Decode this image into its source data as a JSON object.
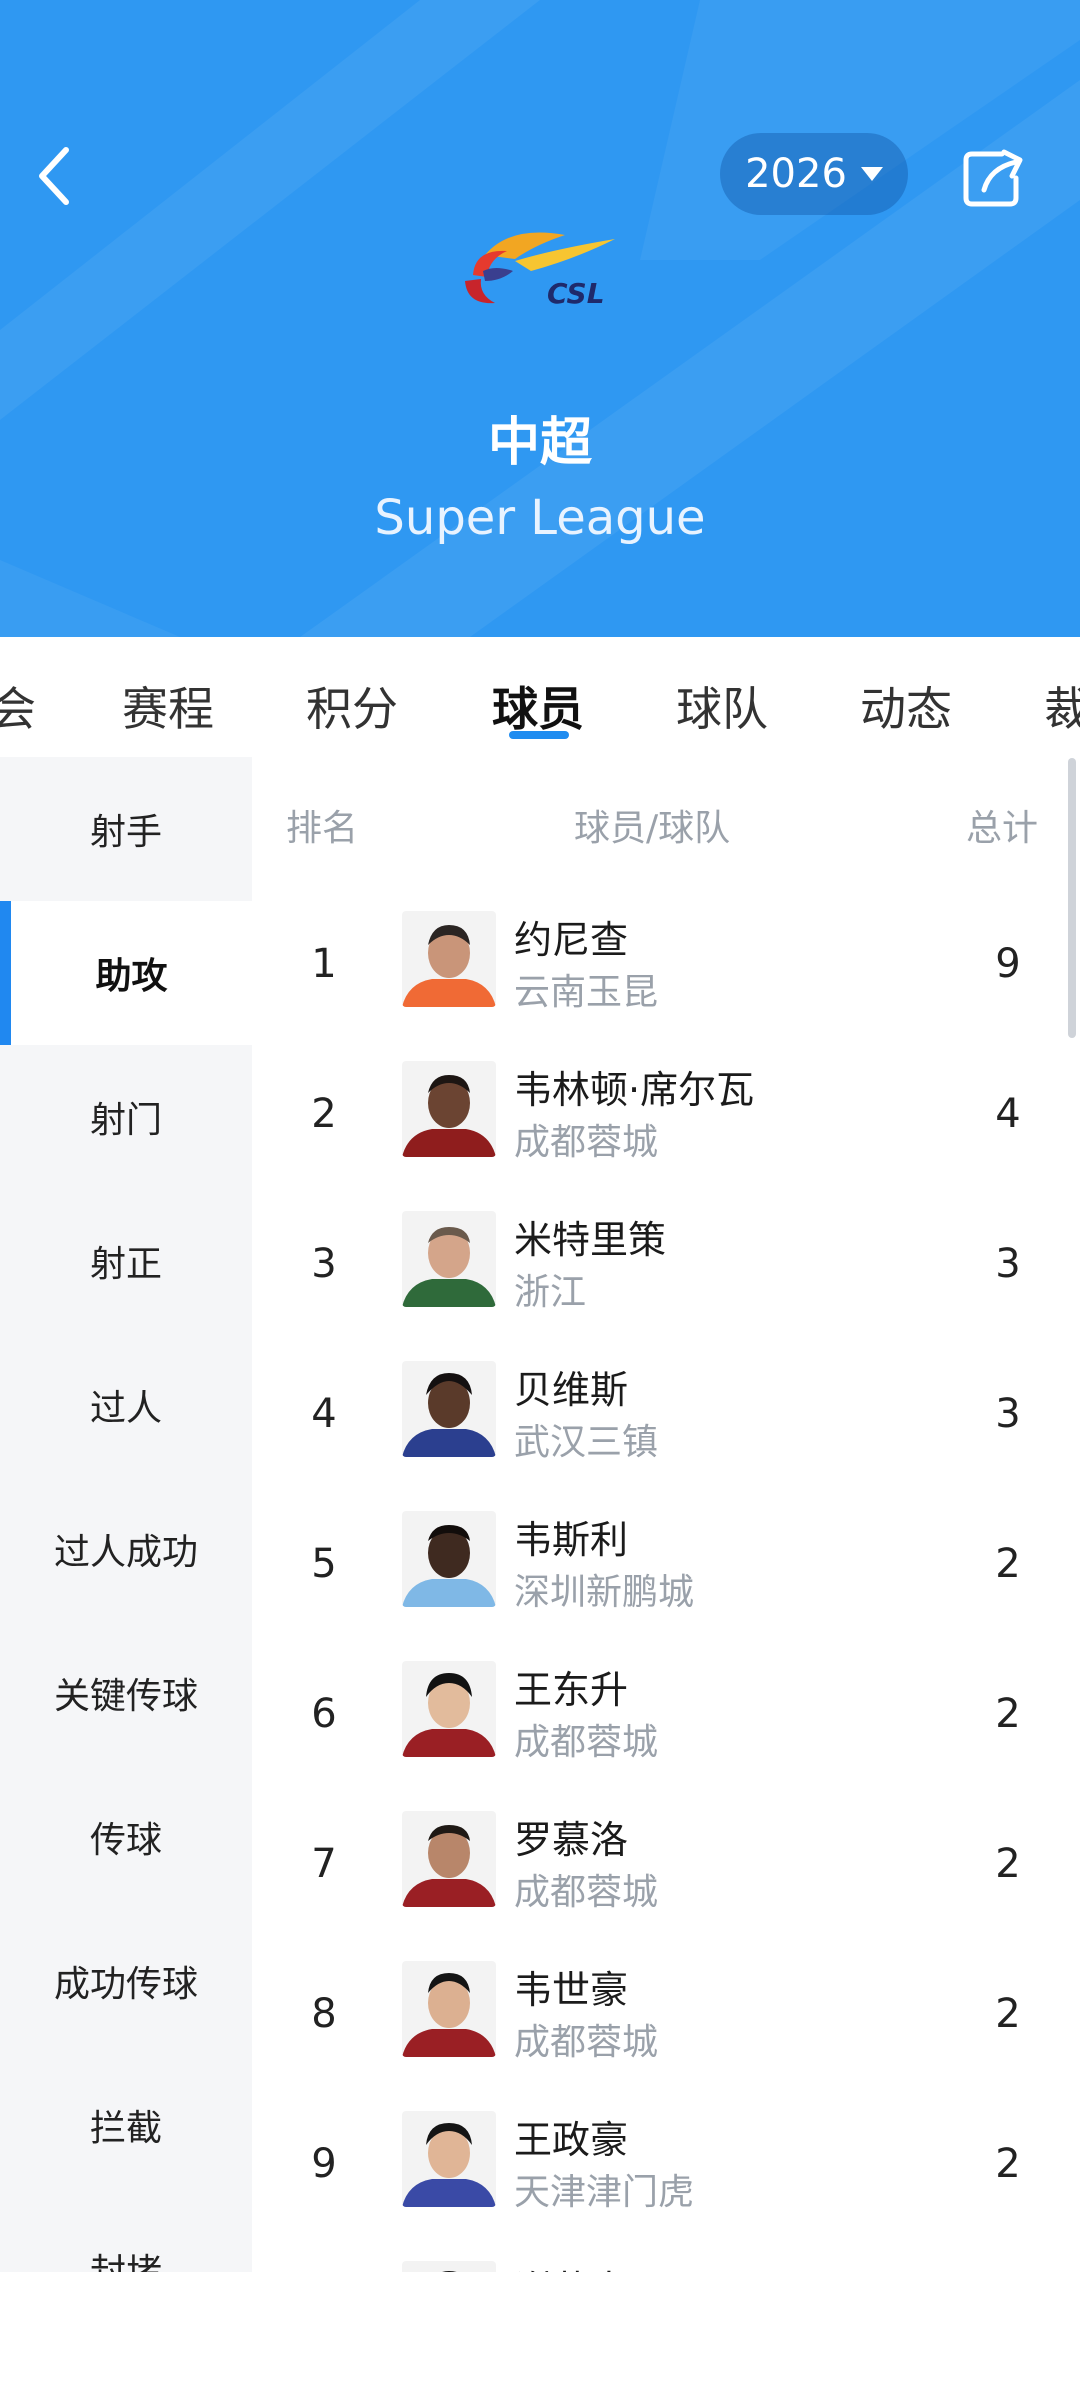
{
  "header": {
    "season": "2026",
    "league_name": "中超",
    "league_name_en": "Super League",
    "logo_text": "CSL",
    "colors": {
      "header_bg": "#2f98f2",
      "accent": "#1f8cf0"
    },
    "icons": {
      "back": "back-chevron-icon",
      "season_dropdown": "caret-down-icon",
      "share": "share-icon"
    }
  },
  "tabs": [
    {
      "label": "会"
    },
    {
      "label": "赛程"
    },
    {
      "label": "积分"
    },
    {
      "label": "球员",
      "active": true
    },
    {
      "label": "球队"
    },
    {
      "label": "动态"
    },
    {
      "label": "裁"
    }
  ],
  "sidebar": [
    {
      "label": "射手"
    },
    {
      "label": "助攻",
      "active": true
    },
    {
      "label": "射门"
    },
    {
      "label": "射正"
    },
    {
      "label": "过人"
    },
    {
      "label": "过人成功"
    },
    {
      "label": "关键传球"
    },
    {
      "label": "传球"
    },
    {
      "label": "成功传球"
    },
    {
      "label": "拦截"
    },
    {
      "label": "封堵"
    }
  ],
  "table": {
    "headers": {
      "rank": "排名",
      "player_team": "球员/球队",
      "total": "总计"
    },
    "rows": [
      {
        "rank": "1",
        "player": "约尼查",
        "team": "云南玉昆",
        "total": "9"
      },
      {
        "rank": "2",
        "player": "韦林顿·席尔瓦",
        "team": "成都蓉城",
        "total": "4"
      },
      {
        "rank": "3",
        "player": "米特里策",
        "team": "浙江",
        "total": "3"
      },
      {
        "rank": "4",
        "player": "贝维斯",
        "team": "武汉三镇",
        "total": "3"
      },
      {
        "rank": "5",
        "player": "韦斯利",
        "team": "深圳新鹏城",
        "total": "2"
      },
      {
        "rank": "6",
        "player": "王东升",
        "team": "成都蓉城",
        "total": "2"
      },
      {
        "rank": "7",
        "player": "罗慕洛",
        "team": "成都蓉城",
        "total": "2"
      },
      {
        "rank": "8",
        "player": "韦世豪",
        "team": "成都蓉城",
        "total": "2"
      },
      {
        "rank": "9",
        "player": "王政豪",
        "team": "天津津门虎",
        "total": "2"
      },
      {
        "rank": "",
        "player": "谢蕾中",
        "team": "",
        "total": ""
      }
    ]
  }
}
